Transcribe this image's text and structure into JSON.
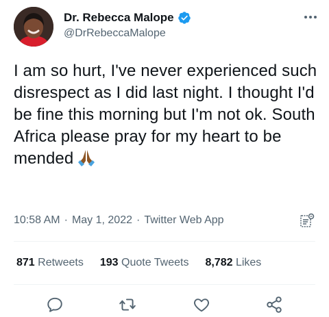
{
  "author": {
    "display_name": "Dr. Rebecca Malope",
    "handle": "@DrRebeccaMalope"
  },
  "tweet": {
    "text": "I am so hurt, I've never experienced such disrespect as I did last night. I thought I'd be fine this morning but I'm not ok. South Africa please pray for my heart to be mended",
    "time": "10:58 AM",
    "date": "May 1, 2022",
    "source": "Twitter Web App"
  },
  "stats": {
    "retweets": {
      "count": "871",
      "label": "Retweets"
    },
    "quotes": {
      "count": "193",
      "label": "Quote Tweets"
    },
    "likes": {
      "count": "8,782",
      "label": "Likes"
    }
  },
  "icons": {
    "verified": "verified-badge-icon",
    "more": "more-dots-icon",
    "emoji": "folded-hands-emoji",
    "analytics": "analytics-icon",
    "reply": "reply-icon",
    "retweet": "retweet-icon",
    "like": "like-icon",
    "share": "share-icon"
  },
  "colors": {
    "text": "#0f1419",
    "secondary": "#536471",
    "verified_blue": "#1d9bf0",
    "divider": "#eff3f4"
  }
}
